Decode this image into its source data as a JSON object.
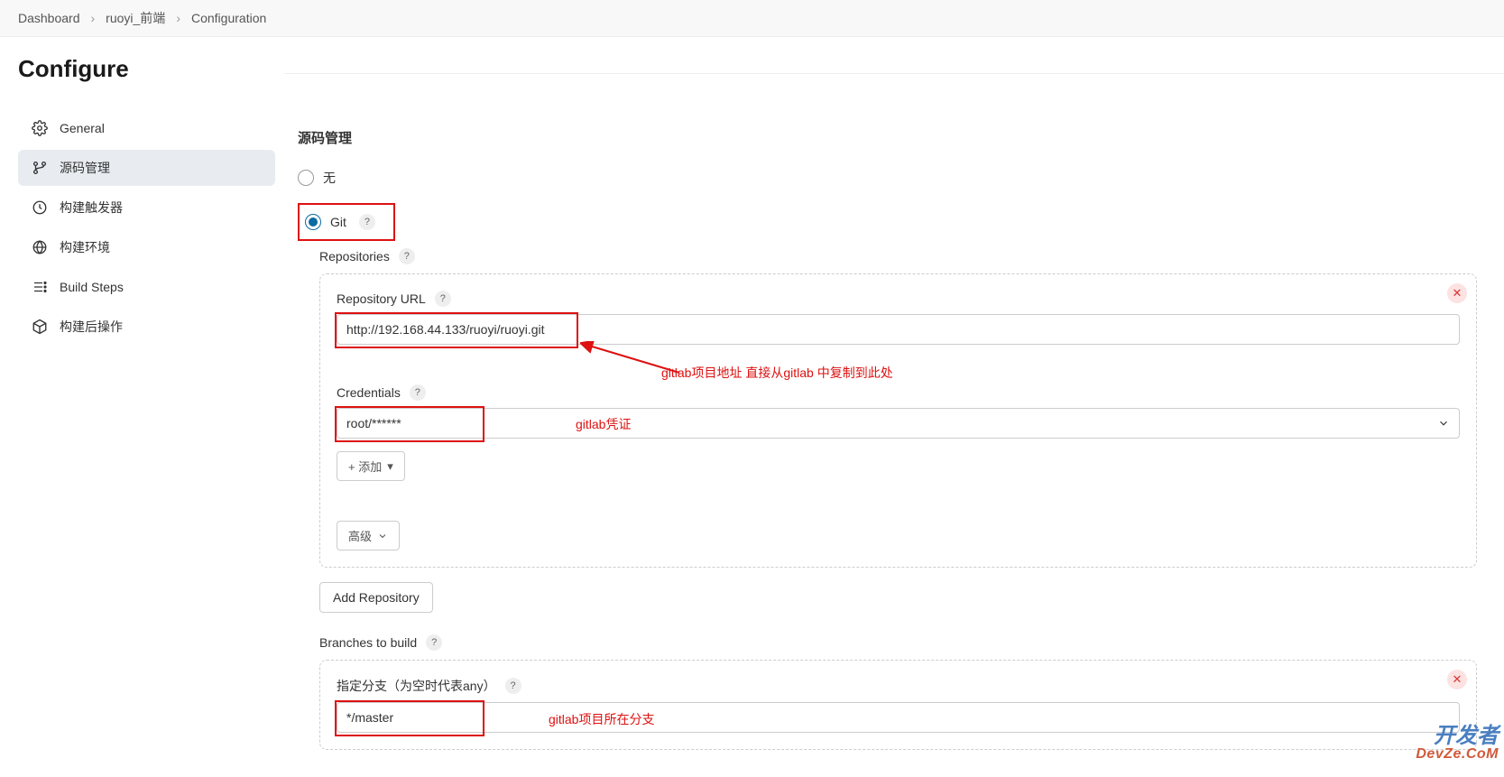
{
  "breadcrumb": {
    "items": [
      "Dashboard",
      "ruoyi_前端",
      "Configuration"
    ]
  },
  "page_title": "Configure",
  "sidebar": {
    "items": [
      {
        "label": "General"
      },
      {
        "label": "源码管理"
      },
      {
        "label": "构建触发器"
      },
      {
        "label": "构建环境"
      },
      {
        "label": "Build Steps"
      },
      {
        "label": "构建后操作"
      }
    ],
    "active_index": 1
  },
  "section": {
    "title": "源码管理",
    "option_none": "无",
    "option_git": "Git",
    "repositories_label": "Repositories",
    "repo_url_label": "Repository URL",
    "repo_url_value": "http://192.168.44.133/ruoyi/ruoyi.git",
    "credentials_label": "Credentials",
    "credentials_value": "root/******",
    "add_btn": "+ 添加",
    "advanced_btn": "高级",
    "add_repo_btn": "Add Repository",
    "branches_label": "Branches to build",
    "branch_spec_label": "指定分支（为空时代表any）",
    "branch_value": "*/master"
  },
  "annotations": {
    "url_note": "gitlab项目地址   直接从gitlab 中复制到此处",
    "cred_note": "gitlab凭证",
    "branch_note": "gitlab项目所在分支"
  },
  "watermark": {
    "line1": "开发者",
    "line2": "DevZe.CoM"
  }
}
